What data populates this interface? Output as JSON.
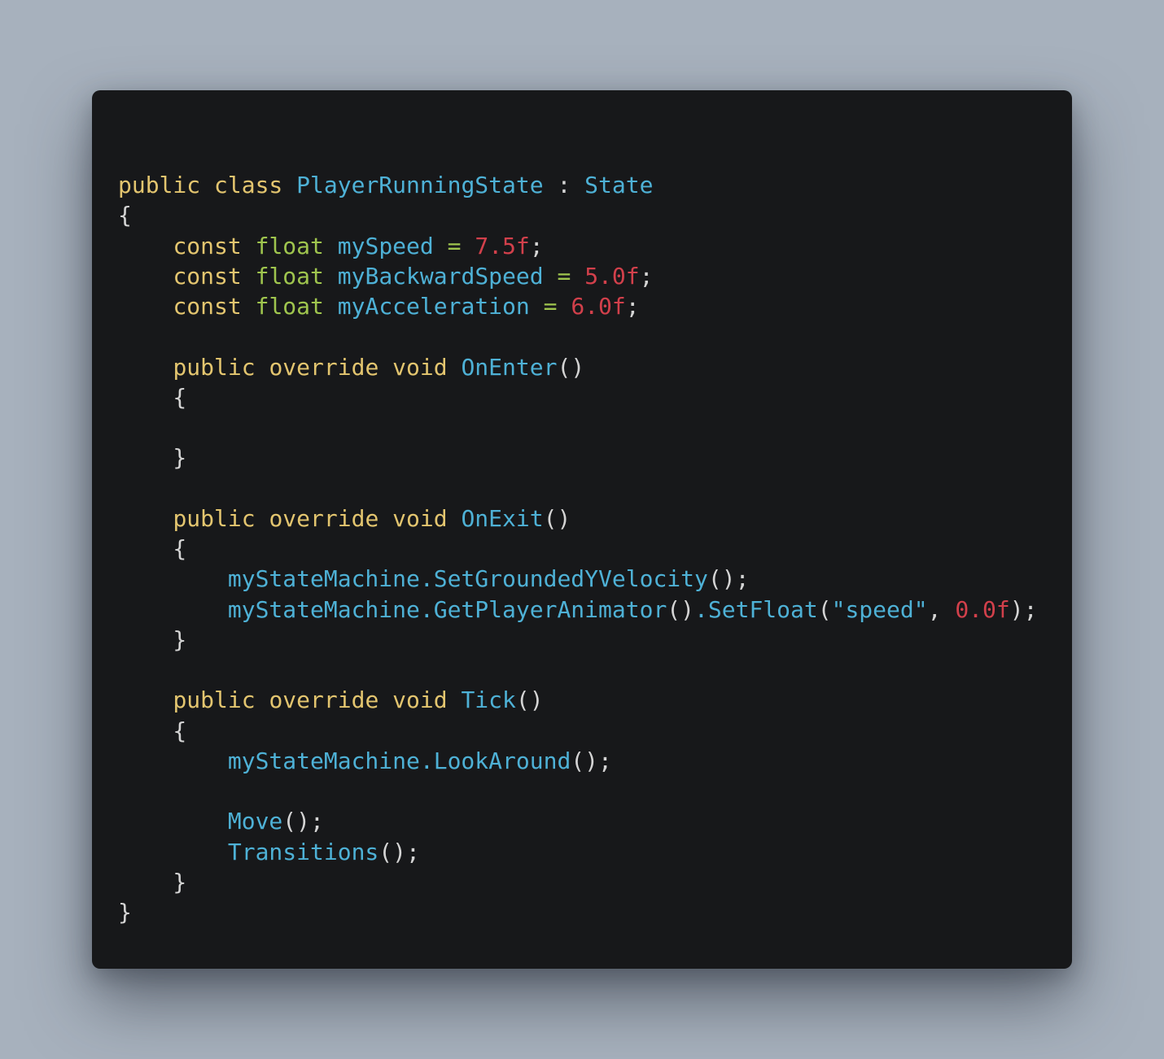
{
  "colors": {
    "background": "#a7b1bd",
    "panel": "#17181a",
    "keyword": "#e3c56f",
    "type": "#9fc54e",
    "identifier": "#4eb1d6",
    "number": "#d2404b",
    "punctuation": "#d4d4d4"
  },
  "code": {
    "language": "C#",
    "lines": [
      [
        {
          "t": "kw",
          "v": "public class "
        },
        {
          "t": "id",
          "v": "PlayerRunningState"
        },
        {
          "t": "pn",
          "v": " : "
        },
        {
          "t": "id",
          "v": "State"
        }
      ],
      [
        {
          "t": "pn",
          "v": "{"
        }
      ],
      [
        {
          "t": "pn",
          "v": "    "
        },
        {
          "t": "kw",
          "v": "const "
        },
        {
          "t": "ty",
          "v": "float "
        },
        {
          "t": "id",
          "v": "mySpeed"
        },
        {
          "t": "ty",
          "v": " = "
        },
        {
          "t": "num",
          "v": "7.5f"
        },
        {
          "t": "pn",
          "v": ";"
        }
      ],
      [
        {
          "t": "pn",
          "v": "    "
        },
        {
          "t": "kw",
          "v": "const "
        },
        {
          "t": "ty",
          "v": "float "
        },
        {
          "t": "id",
          "v": "myBackwardSpeed"
        },
        {
          "t": "ty",
          "v": " = "
        },
        {
          "t": "num",
          "v": "5.0f"
        },
        {
          "t": "pn",
          "v": ";"
        }
      ],
      [
        {
          "t": "pn",
          "v": "    "
        },
        {
          "t": "kw",
          "v": "const "
        },
        {
          "t": "ty",
          "v": "float "
        },
        {
          "t": "id",
          "v": "myAcceleration"
        },
        {
          "t": "ty",
          "v": " = "
        },
        {
          "t": "num",
          "v": "6.0f"
        },
        {
          "t": "pn",
          "v": ";"
        }
      ],
      [],
      [
        {
          "t": "pn",
          "v": "    "
        },
        {
          "t": "kw",
          "v": "public override void "
        },
        {
          "t": "id",
          "v": "OnEnter"
        },
        {
          "t": "pn",
          "v": "()"
        }
      ],
      [
        {
          "t": "pn",
          "v": "    {"
        }
      ],
      [],
      [
        {
          "t": "pn",
          "v": "    }"
        }
      ],
      [],
      [
        {
          "t": "pn",
          "v": "    "
        },
        {
          "t": "kw",
          "v": "public override void "
        },
        {
          "t": "id",
          "v": "OnExit"
        },
        {
          "t": "pn",
          "v": "()"
        }
      ],
      [
        {
          "t": "pn",
          "v": "    {"
        }
      ],
      [
        {
          "t": "pn",
          "v": "        "
        },
        {
          "t": "id",
          "v": "myStateMachine.SetGroundedYVelocity"
        },
        {
          "t": "pn",
          "v": "();"
        }
      ],
      [
        {
          "t": "pn",
          "v": "        "
        },
        {
          "t": "id",
          "v": "myStateMachine.GetPlayerAnimator"
        },
        {
          "t": "pn",
          "v": "()"
        },
        {
          "t": "id",
          "v": ".SetFloat"
        },
        {
          "t": "pn",
          "v": "("
        },
        {
          "t": "str",
          "v": "\"speed\""
        },
        {
          "t": "pn",
          "v": ", "
        },
        {
          "t": "num",
          "v": "0.0f"
        },
        {
          "t": "pn",
          "v": ");"
        }
      ],
      [
        {
          "t": "pn",
          "v": "    }"
        }
      ],
      [],
      [
        {
          "t": "pn",
          "v": "    "
        },
        {
          "t": "kw",
          "v": "public override void "
        },
        {
          "t": "id",
          "v": "Tick"
        },
        {
          "t": "pn",
          "v": "()"
        }
      ],
      [
        {
          "t": "pn",
          "v": "    {"
        }
      ],
      [
        {
          "t": "pn",
          "v": "        "
        },
        {
          "t": "id",
          "v": "myStateMachine.LookAround"
        },
        {
          "t": "pn",
          "v": "();"
        }
      ],
      [],
      [
        {
          "t": "pn",
          "v": "        "
        },
        {
          "t": "id",
          "v": "Move"
        },
        {
          "t": "pn",
          "v": "();"
        }
      ],
      [
        {
          "t": "pn",
          "v": "        "
        },
        {
          "t": "id",
          "v": "Transitions"
        },
        {
          "t": "pn",
          "v": "();"
        }
      ],
      [
        {
          "t": "pn",
          "v": "    }"
        }
      ],
      [
        {
          "t": "pn",
          "v": "}"
        }
      ]
    ]
  }
}
